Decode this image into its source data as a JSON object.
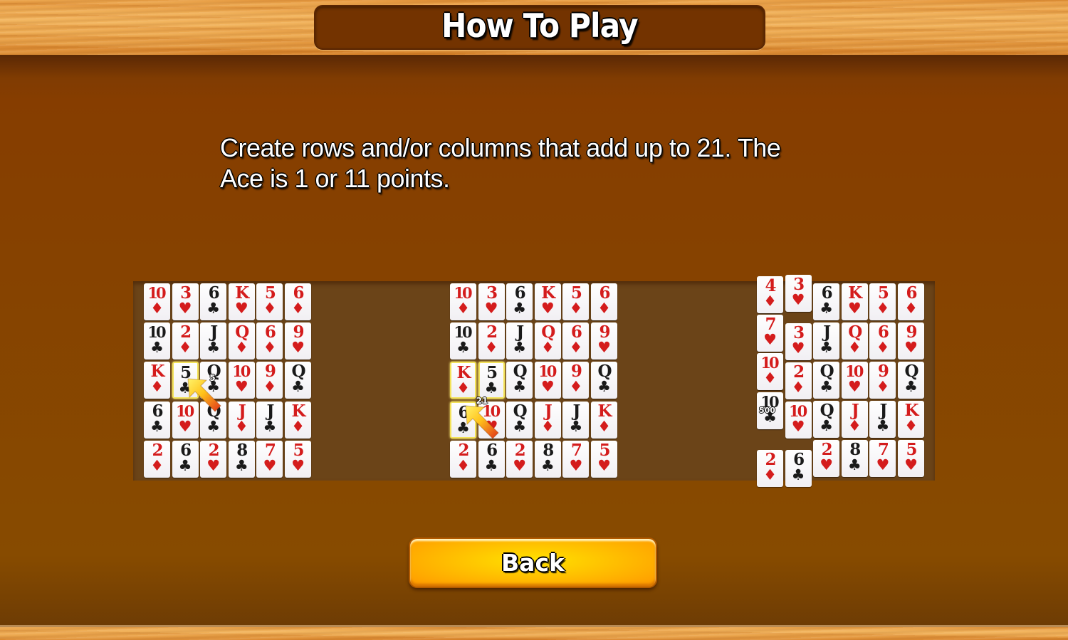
{
  "header": {
    "title": "How To Play"
  },
  "instructions": {
    "line1": "Create rows and/or columns that add up to 21. The",
    "line2": "Ace is 1 or 11 points."
  },
  "colors": {
    "red_suit": "#d41c1c",
    "black_suit": "#1a1a1a",
    "highlight": "#f3e25a",
    "button": "#ffc400"
  },
  "suits": {
    "diamonds": "♦",
    "hearts": "♥",
    "clubs": "♣"
  },
  "boards": [
    {
      "step": 1,
      "grid": [
        [
          [
            "10",
            "diamonds"
          ],
          [
            "3",
            "hearts"
          ],
          [
            "6",
            "clubs"
          ],
          [
            "K",
            "hearts"
          ],
          [
            "5",
            "diamonds"
          ],
          [
            "6",
            "diamonds"
          ]
        ],
        [
          [
            "10",
            "clubs"
          ],
          [
            "2",
            "diamonds"
          ],
          [
            "J",
            "clubs"
          ],
          [
            "Q",
            "diamonds"
          ],
          [
            "6",
            "diamonds"
          ],
          [
            "9",
            "hearts"
          ]
        ],
        [
          [
            "K",
            "diamonds"
          ],
          [
            "5",
            "clubs"
          ],
          [
            "Q",
            "clubs"
          ],
          [
            "10",
            "hearts"
          ],
          [
            "9",
            "diamonds"
          ],
          [
            "Q",
            "clubs"
          ]
        ],
        [
          [
            "6",
            "clubs"
          ],
          [
            "10",
            "hearts"
          ],
          [
            "Q",
            "clubs"
          ],
          [
            "J",
            "diamonds"
          ],
          [
            "J",
            "clubs"
          ],
          [
            "K",
            "diamonds"
          ]
        ],
        [
          [
            "2",
            "diamonds"
          ],
          [
            "6",
            "clubs"
          ],
          [
            "2",
            "hearts"
          ],
          [
            "8",
            "clubs"
          ],
          [
            "7",
            "hearts"
          ],
          [
            "5",
            "hearts"
          ]
        ]
      ],
      "selected": [
        [
          2,
          1
        ]
      ],
      "badge": "5",
      "pointer": "arrow-up-left"
    },
    {
      "step": 2,
      "grid": [
        [
          [
            "10",
            "diamonds"
          ],
          [
            "3",
            "hearts"
          ],
          [
            "6",
            "clubs"
          ],
          [
            "K",
            "hearts"
          ],
          [
            "5",
            "diamonds"
          ],
          [
            "6",
            "diamonds"
          ]
        ],
        [
          [
            "10",
            "clubs"
          ],
          [
            "2",
            "diamonds"
          ],
          [
            "J",
            "clubs"
          ],
          [
            "Q",
            "diamonds"
          ],
          [
            "6",
            "diamonds"
          ],
          [
            "9",
            "hearts"
          ]
        ],
        [
          [
            "K",
            "diamonds"
          ],
          [
            "5",
            "clubs"
          ],
          [
            "Q",
            "clubs"
          ],
          [
            "10",
            "hearts"
          ],
          [
            "9",
            "diamonds"
          ],
          [
            "Q",
            "clubs"
          ]
        ],
        [
          [
            "6",
            "clubs"
          ],
          [
            "10",
            "hearts"
          ],
          [
            "Q",
            "clubs"
          ],
          [
            "J",
            "diamonds"
          ],
          [
            "J",
            "clubs"
          ],
          [
            "K",
            "diamonds"
          ]
        ],
        [
          [
            "2",
            "diamonds"
          ],
          [
            "6",
            "clubs"
          ],
          [
            "2",
            "hearts"
          ],
          [
            "8",
            "clubs"
          ],
          [
            "7",
            "hearts"
          ],
          [
            "5",
            "hearts"
          ]
        ]
      ],
      "selected": [
        [
          2,
          0
        ],
        [
          2,
          1
        ],
        [
          3,
          0
        ]
      ],
      "badge": "21",
      "pointer": "arrow-up-left"
    },
    {
      "step": 3,
      "columns": [
        [
          [
            "4",
            "diamonds"
          ],
          [
            "7",
            "hearts"
          ],
          [
            "10",
            "diamonds"
          ],
          [
            "10",
            "clubs"
          ],
          [
            "2",
            "diamonds"
          ]
        ],
        [
          [
            "3",
            "hearts"
          ],
          [
            "3",
            "hearts"
          ],
          [
            "2",
            "diamonds"
          ],
          [
            "10",
            "hearts"
          ],
          [
            "6",
            "clubs"
          ]
        ],
        [
          [
            "6",
            "clubs"
          ],
          [
            "J",
            "clubs"
          ],
          [
            "Q",
            "clubs"
          ],
          [
            "Q",
            "clubs"
          ],
          [
            "2",
            "hearts"
          ]
        ],
        [
          [
            "K",
            "hearts"
          ],
          [
            "Q",
            "diamonds"
          ],
          [
            "10",
            "hearts"
          ],
          [
            "J",
            "diamonds"
          ],
          [
            "8",
            "clubs"
          ]
        ],
        [
          [
            "5",
            "diamonds"
          ],
          [
            "6",
            "diamonds"
          ],
          [
            "9",
            "diamonds"
          ],
          [
            "J",
            "clubs"
          ],
          [
            "7",
            "hearts"
          ]
        ],
        [
          [
            "6",
            "diamonds"
          ],
          [
            "9",
            "hearts"
          ],
          [
            "Q",
            "clubs"
          ],
          [
            "K",
            "diamonds"
          ],
          [
            "5",
            "hearts"
          ]
        ]
      ],
      "badge": "500"
    }
  ],
  "back_button": {
    "label": "Back"
  }
}
